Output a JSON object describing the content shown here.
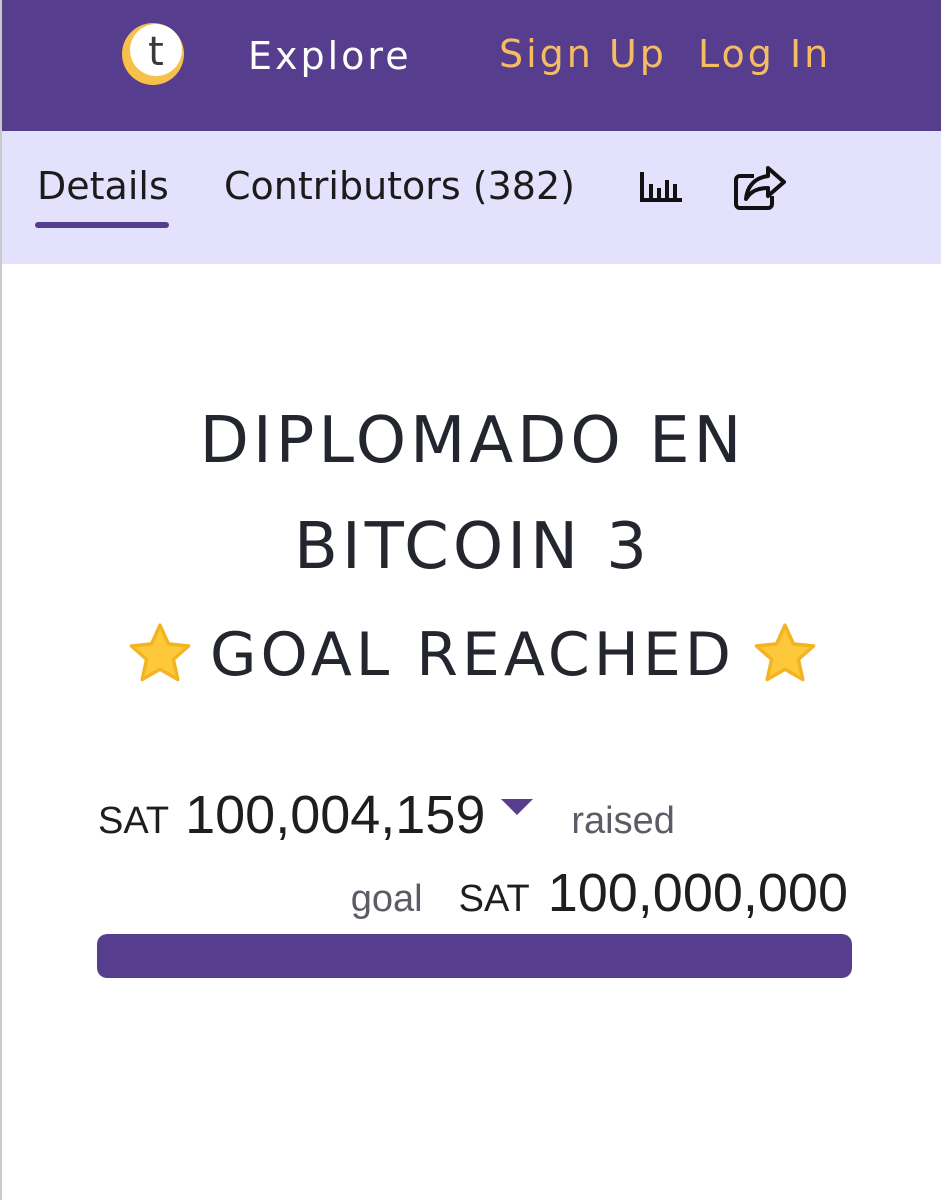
{
  "nav": {
    "explore": "Explore",
    "sign_up": "Sign Up",
    "log_in": "Log In",
    "logo_letter": "t"
  },
  "tabs": {
    "details": "Details",
    "contributors": "Contributors (382)",
    "stats_icon": "bar-chart-icon",
    "share_icon": "share-icon"
  },
  "campaign": {
    "title_line1": "DIPLOMADO EN",
    "title_line2": "BITCOIN 3",
    "status": "GOAL REACHED",
    "raised_currency": "SAT",
    "raised_amount": "100,004,159",
    "raised_label": "raised",
    "goal_label": "goal",
    "goal_currency": "SAT",
    "goal_amount": "100,000,000",
    "progress_fraction": 1.0
  },
  "colors": {
    "brand_purple": "#563d8e",
    "accent_gold": "#f6bc62",
    "tab_bar_bg": "#e3e1fb",
    "star": "#fdc93a"
  }
}
